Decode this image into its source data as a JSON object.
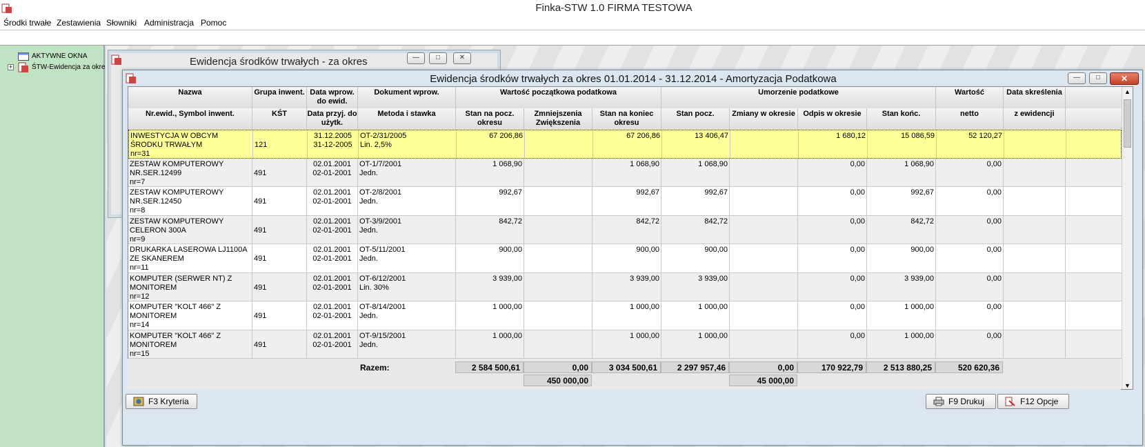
{
  "app": {
    "title": "Finka-STW 1.0 FIRMA TESTOWA"
  },
  "menu": [
    "Środki trwałe",
    "Zestawienia",
    "Słowniki",
    "Administracja",
    "Pomoc"
  ],
  "tree": {
    "root": "AKTYWNE OKNA",
    "child": "ŚTW-Ewidencja za okre"
  },
  "win1": {
    "title": "Ewidencja środków trwałych - za okres"
  },
  "win2": {
    "title": "Ewidencja środków trwałych za okres 01.01.2014 - 31.12.2014  - Amortyzacja Podatkowa"
  },
  "header": {
    "row1": [
      "Nazwa",
      "Grupa inwent.",
      "Data wprow. do ewid.",
      "Dokument wprow.",
      "Wartość początkowa podatkowa",
      "Umorzenie podatkowe",
      "Wartość",
      "Data skreślenia"
    ],
    "row2": [
      "Nr.ewid., Symbol inwent.",
      "KŚT",
      "Data przyj. do użytk.",
      "Metoda i stawka",
      "Stan na pocz. okresu",
      "Zmniejszenia Zwiększenia",
      "Stan na koniec okresu",
      "Stan pocz.",
      "Zmiany w okresie",
      "Odpis w okresie",
      "Stan końc.",
      "netto",
      "z ewidencji"
    ]
  },
  "rows": [
    {
      "name": "INWESTYCJA W OBCYM ŚRODKU TRWAŁYM",
      "nr": "nr=31",
      "group": "121",
      "d1": "31.12.2005",
      "d2": "31-12-2005",
      "doc": "OT-2/31/2005",
      "method": "Lin. 2,5%",
      "start": "67 206,86",
      "chg": "",
      "end": "67 206,86",
      "u_start": "13 406,47",
      "u_chg": "",
      "odpis": "1 680,12",
      "u_end": "15 086,59",
      "netto": "52 120,27",
      "del": ""
    },
    {
      "name": "ZESTAW KOMPUTEROWY NR.SER.12499",
      "nr": "nr=7",
      "group": "491",
      "d1": "02.01.2001",
      "d2": "02-01-2001",
      "doc": "OT-1/7/2001",
      "method": "Jedn.",
      "start": "1 068,90",
      "chg": "",
      "end": "1 068,90",
      "u_start": "1 068,90",
      "u_chg": "",
      "odpis": "0,00",
      "u_end": "1 068,90",
      "netto": "0,00",
      "del": ""
    },
    {
      "name": "ZESTAW KOMPUTEROWY NR.SER.12450",
      "nr": "nr=8",
      "group": "491",
      "d1": "02.01.2001",
      "d2": "02-01-2001",
      "doc": "OT-2/8/2001",
      "method": "Jedn.",
      "start": "992,67",
      "chg": "",
      "end": "992,67",
      "u_start": "992,67",
      "u_chg": "",
      "odpis": "0,00",
      "u_end": "992,67",
      "netto": "0,00",
      "del": ""
    },
    {
      "name": "ZESTAW KOMPUTEROWY CELERON 300A",
      "nr": "nr=9",
      "group": "491",
      "d1": "02.01.2001",
      "d2": "02-01-2001",
      "doc": "OT-3/9/2001",
      "method": "Jedn.",
      "start": "842,72",
      "chg": "",
      "end": "842,72",
      "u_start": "842,72",
      "u_chg": "",
      "odpis": "0,00",
      "u_end": "842,72",
      "netto": "0,00",
      "del": ""
    },
    {
      "name": "DRUKARKA LASEROWA LJ1100A ZE SKANEREM",
      "nr": "nr=11",
      "group": "491",
      "d1": "02.01.2001",
      "d2": "02-01-2001",
      "doc": "OT-5/11/2001",
      "method": "Jedn.",
      "start": "900,00",
      "chg": "",
      "end": "900,00",
      "u_start": "900,00",
      "u_chg": "",
      "odpis": "0,00",
      "u_end": "900,00",
      "netto": "0,00",
      "del": ""
    },
    {
      "name": "KOMPUTER (SERWER NT) Z MONITOREM",
      "nr": "nr=12",
      "group": "491",
      "d1": "02.01.2001",
      "d2": "02-01-2001",
      "doc": "OT-6/12/2001",
      "method": "Lin. 30%",
      "start": "3 939,00",
      "chg": "",
      "end": "3 939,00",
      "u_start": "3 939,00",
      "u_chg": "",
      "odpis": "0,00",
      "u_end": "3 939,00",
      "netto": "0,00",
      "del": ""
    },
    {
      "name": "KOMPUTER \"KOLT 466\" Z MONITOREM",
      "nr": "nr=14",
      "group": "491",
      "d1": "02.01.2001",
      "d2": "02-01-2001",
      "doc": "OT-8/14/2001",
      "method": "Jedn.",
      "start": "1 000,00",
      "chg": "",
      "end": "1 000,00",
      "u_start": "1 000,00",
      "u_chg": "",
      "odpis": "0,00",
      "u_end": "1 000,00",
      "netto": "0,00",
      "del": ""
    },
    {
      "name": "KOMPUTER \"KOLT 466\" Z MONITOREM",
      "nr": "nr=15",
      "group": "491",
      "d1": "02.01.2001",
      "d2": "02-01-2001",
      "doc": "OT-9/15/2001",
      "method": "Jedn.",
      "start": "1 000,00",
      "chg": "",
      "end": "1 000,00",
      "u_start": "1 000,00",
      "u_chg": "",
      "odpis": "0,00",
      "u_end": "1 000,00",
      "netto": "0,00",
      "del": ""
    }
  ],
  "totals": {
    "label": "Razem:",
    "start": "2 584 500,61",
    "chg": "0,00",
    "end": "3 034 500,61",
    "u_start": "2 297 957,46",
    "u_chg": "0,00",
    "odpis": "170 922,79",
    "u_end": "2 513 880,25",
    "netto": "520 620,36",
    "chg2": "450 000,00",
    "u_chg2": "45 000,00"
  },
  "buttons": {
    "criteria": "F3  Kryteria",
    "print": "F9  Drukuj",
    "options": "F12  Opcje"
  },
  "colors": {
    "highlight": "#ffff99",
    "alt_row": "#efefef"
  }
}
